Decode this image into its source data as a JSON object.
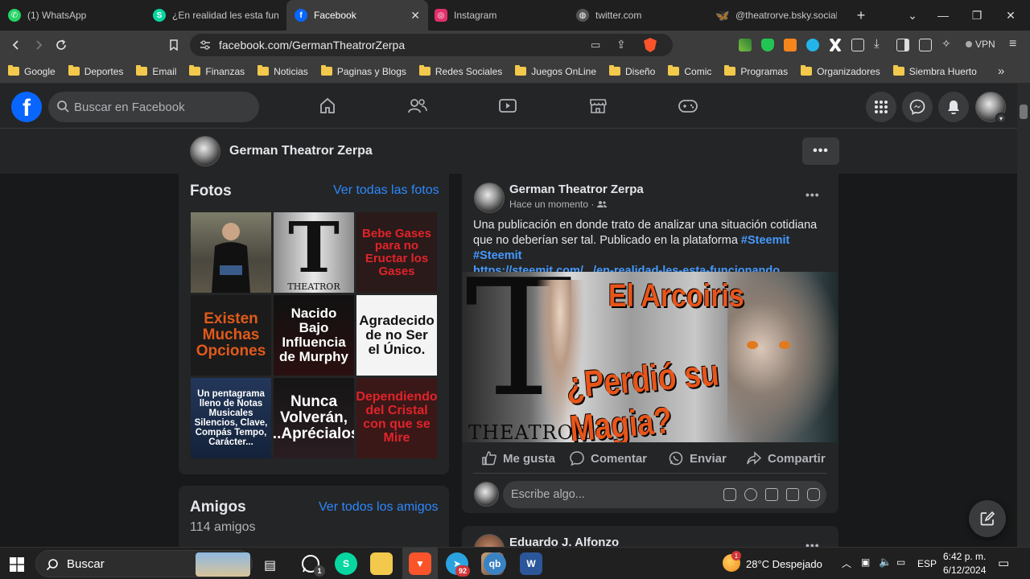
{
  "browser": {
    "tabs": [
      {
        "label": "(1) WhatsApp",
        "icon": "whatsapp-icon",
        "color": "#25d366"
      },
      {
        "label": "¿En realidad les esta funcio",
        "icon": "steemit-icon",
        "color": "#07d6a0"
      },
      {
        "label": "Facebook",
        "icon": "facebook-icon",
        "color": "#0866ff"
      },
      {
        "label": "Instagram",
        "icon": "instagram-icon",
        "color": "#e1306c"
      },
      {
        "label": "twitter.com",
        "icon": "globe-icon",
        "color": "#888888"
      },
      {
        "label": "@theatrorve.bsky.social",
        "icon": "bluesky-icon",
        "color": "#1185fe"
      }
    ],
    "new_tab": "+",
    "url": "facebook.com/GermanTheatrorZerpa",
    "vpn_label": "VPN",
    "bookmarks": [
      "Google",
      "Deportes",
      "Email",
      "Finanzas",
      "Noticias",
      "Paginas y Blogs",
      "Redes Sociales",
      "Juegos OnLine",
      "Diseño",
      "Comic",
      "Programas",
      "Organizadores",
      "Siembra Huerto"
    ],
    "bookmarks_more": "»"
  },
  "facebook": {
    "logo": "f",
    "search_placeholder": "Buscar en Facebook",
    "profile_name": "German Theatror Zerpa",
    "more": "•••",
    "photos": {
      "title": "Fotos",
      "link": "Ver todas las fotos",
      "items": [
        {
          "text": "",
          "bg": "#6b6b58",
          "fg": "#ffffff"
        },
        {
          "text": "THEATROR",
          "bg": "#cfcfcf",
          "fg": "#111111"
        },
        {
          "text": "Bebe Gases para no Eructar los Gases",
          "bg": "#2a1a1a",
          "fg": "#e0242a"
        },
        {
          "text": "Existen Muchas Opciones",
          "bg": "#1b1b1b",
          "fg": "#e05a1a"
        },
        {
          "text": "Nacido Bajo Influencia de Murphy",
          "bg": "#1a0d0d",
          "fg": "#ffffff"
        },
        {
          "text": "Agradecido de no Ser el Único.",
          "bg": "#f4f4f4",
          "fg": "#111111"
        },
        {
          "text": "Un pentagrama lleno de Notas Musicales Silencios, Clave, Compás Tempo, Carácter...",
          "bg": "#1d2e4a",
          "fg": "#ffffff"
        },
        {
          "text": "Nunca Volverán, ...Aprécialos",
          "bg": "#151515",
          "fg": "#ffffff"
        },
        {
          "text": "Dependiendo del Cristal con que se Mire",
          "bg": "#3a1818",
          "fg": "#e0242a"
        }
      ]
    },
    "friends": {
      "title": "Amigos",
      "link": "Ver todos los amigos",
      "count": "114 amigos"
    },
    "post": {
      "author": "German Theatror Zerpa",
      "time": "Hace un momento ·",
      "text_main": "Una publicación en donde trato de analizar una situación cotidiana que no deberían ser tal. Publicado en la plataforma ",
      "hashtag1": "#Steemit",
      "hashtag2": "#Steemit",
      "link": "https://steemit.com/.../en-realidad-les-esta-funcionando",
      "image_title1": "El Arcoiris",
      "image_title2": "¿Perdió su Magia?",
      "image_brand": "THEATROR",
      "image_letter": "T",
      "actions": {
        "like": "Me gusta",
        "comment": "Comentar",
        "send": "Enviar",
        "share": "Compartir"
      },
      "comment_placeholder": "Escribe algo..."
    },
    "next_post_author": "Eduardo J. Alfonzo"
  },
  "taskbar": {
    "search": "Buscar",
    "whatsapp_badge": "1",
    "telegram_badge": "92",
    "weather_badge": "1",
    "weather": "28°C  Despejado",
    "language": "ESP",
    "time": "6:42 p. m.",
    "date": "6/12/2024"
  },
  "colors": {
    "fb_blue": "#0866ff",
    "link_blue": "#2d88ff",
    "bg": "#18191a",
    "card": "#242526"
  }
}
